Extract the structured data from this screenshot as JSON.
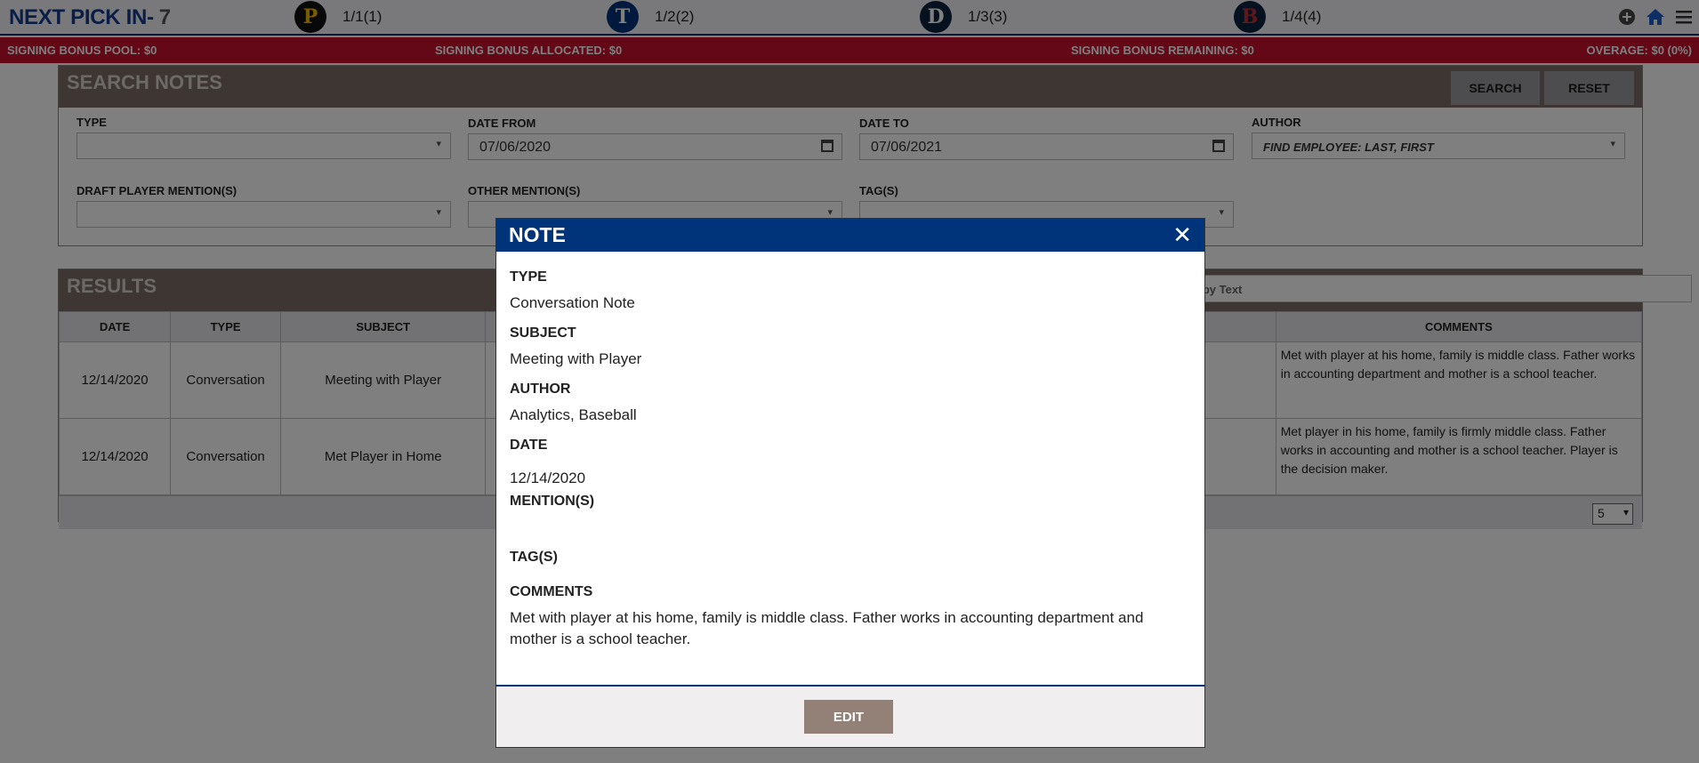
{
  "topbar": {
    "next_pick_label": "NEXT PICK IN-",
    "next_pick_value": "7",
    "picks": [
      {
        "label": "1/1(1)",
        "logo_letter": "P",
        "logo_bg": "#111111",
        "logo_fg": "#f5b800",
        "icon": "pirates-logo-icon"
      },
      {
        "label": "1/2(2)",
        "logo_letter": "T",
        "logo_bg": "#003278",
        "logo_fg": "#ffffff",
        "icon": "rangers-logo-icon"
      },
      {
        "label": "1/3(3)",
        "logo_letter": "D",
        "logo_bg": "#0c2340",
        "logo_fg": "#ffffff",
        "icon": "tigers-logo-icon"
      },
      {
        "label": "1/4(4)",
        "logo_letter": "B",
        "logo_bg": "#0c2340",
        "logo_fg": "#bd3039",
        "icon": "red-sox-logo-icon"
      }
    ],
    "icons": [
      "plus-circle-icon",
      "home-icon",
      "hamburger-menu-icon"
    ]
  },
  "bonus": {
    "pool": "SIGNING BONUS POOL: $0",
    "allocated": "SIGNING BONUS ALLOCATED: $0",
    "remaining": "SIGNING BONUS REMAINING: $0",
    "overage": "OVERAGE: $0 (0%)"
  },
  "search_notes": {
    "title": "SEARCH NOTES",
    "search_label": "SEARCH",
    "reset_label": "RESET",
    "type_label": "TYPE",
    "type_value": "",
    "date_from_label": "DATE FROM",
    "date_from_value": "07/06/2020",
    "date_to_label": "DATE TO",
    "date_to_value": "07/06/2021",
    "author_label": "AUTHOR",
    "author_placeholder": "FIND EMPLOYEE: LAST, FIRST",
    "draft_label": "DRAFT PLAYER MENTION(S)",
    "other_label": "OTHER MENTION(S)",
    "tags_label": "TAG(S)"
  },
  "results": {
    "title": "RESULTS",
    "search_placeholder": "s by Text",
    "columns": {
      "date": "DATE",
      "type": "TYPE",
      "subject": "SUBJECT",
      "comments": "COMMENTS"
    },
    "rows": [
      {
        "date": "12/14/2020",
        "type": "Conversation",
        "subject": "Meeting with Player",
        "comments": "Met with player at his home, family is middle class. Father works in accounting department and mother is a school teacher."
      },
      {
        "date": "12/14/2020",
        "type": "Conversation",
        "subject": "Met Player in Home",
        "comments": "Met player in his home, family is firmly middle class. Father works in accounting and mother is a school teacher. Player is the decision maker."
      }
    ],
    "page_size": "5"
  },
  "modal": {
    "title": "NOTE",
    "type_label": "TYPE",
    "type_value": "Conversation Note",
    "subject_label": "SUBJECT",
    "subject_value": "Meeting with Player",
    "author_label": "AUTHOR",
    "author_value": "Analytics, Baseball",
    "date_label": "DATE",
    "date_value": "12/14/2020",
    "mentions_label": "MENTION(S)",
    "tags_label": "TAG(S)",
    "comments_label": "COMMENTS",
    "comments_value": "Met with player at his home, family is middle class. Father works in accounting department and mother is a school teacher.",
    "edit_label": "EDIT"
  }
}
